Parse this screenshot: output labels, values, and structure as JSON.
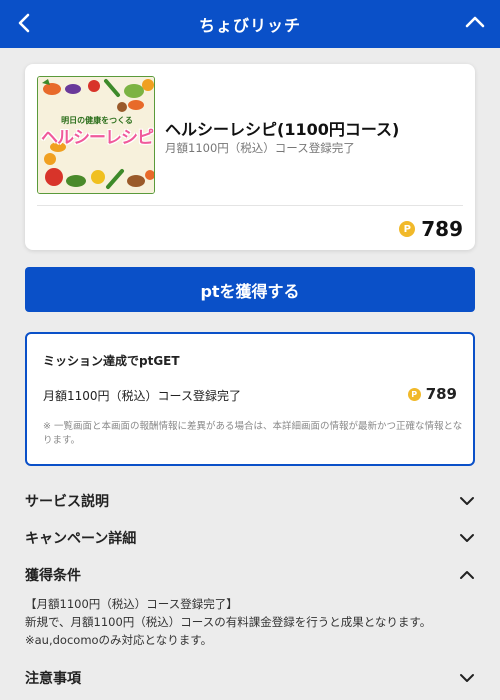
{
  "header": {
    "title": "ちょびリッチ",
    "back_icon": "chevron-left-icon",
    "collapse_icon": "chevron-up-icon",
    "bg_color": "#0a50c8"
  },
  "product": {
    "thumbnail_caption": "明日の健康をつくる",
    "thumbnail_logo": "ヘルシーレシピ",
    "title": "ヘルシーレシピ(1100円コース)",
    "subtitle": "月額1100円（税込）コース登録完了",
    "coin_symbol": "P",
    "points": "789"
  },
  "get_button": {
    "label": "ptを獲得する"
  },
  "mission": {
    "title": "ミッション達成でptGET",
    "condition": "月額1100円（税込）コース登録完了",
    "coin_symbol": "P",
    "points": "789",
    "note": "※ 一覧画面と本画面の報酬情報に差異がある場合は、本詳細画面の情報が最新かつ正確な情報となります。"
  },
  "accordions": [
    {
      "label": "サービス説明",
      "state": "collapsed"
    },
    {
      "label": "キャンペーン詳細",
      "state": "collapsed"
    },
    {
      "label": "獲得条件",
      "state": "expanded"
    },
    {
      "label": "注意事項",
      "state": "collapsed"
    }
  ],
  "conditions": {
    "line1": "【月額1100円（税込）コース登録完了】",
    "line2": "新規で、月額1100円（税込）コースの有料課金登録を行うと成果となります。",
    "line3": "※au,docomoのみ対応となります。"
  }
}
